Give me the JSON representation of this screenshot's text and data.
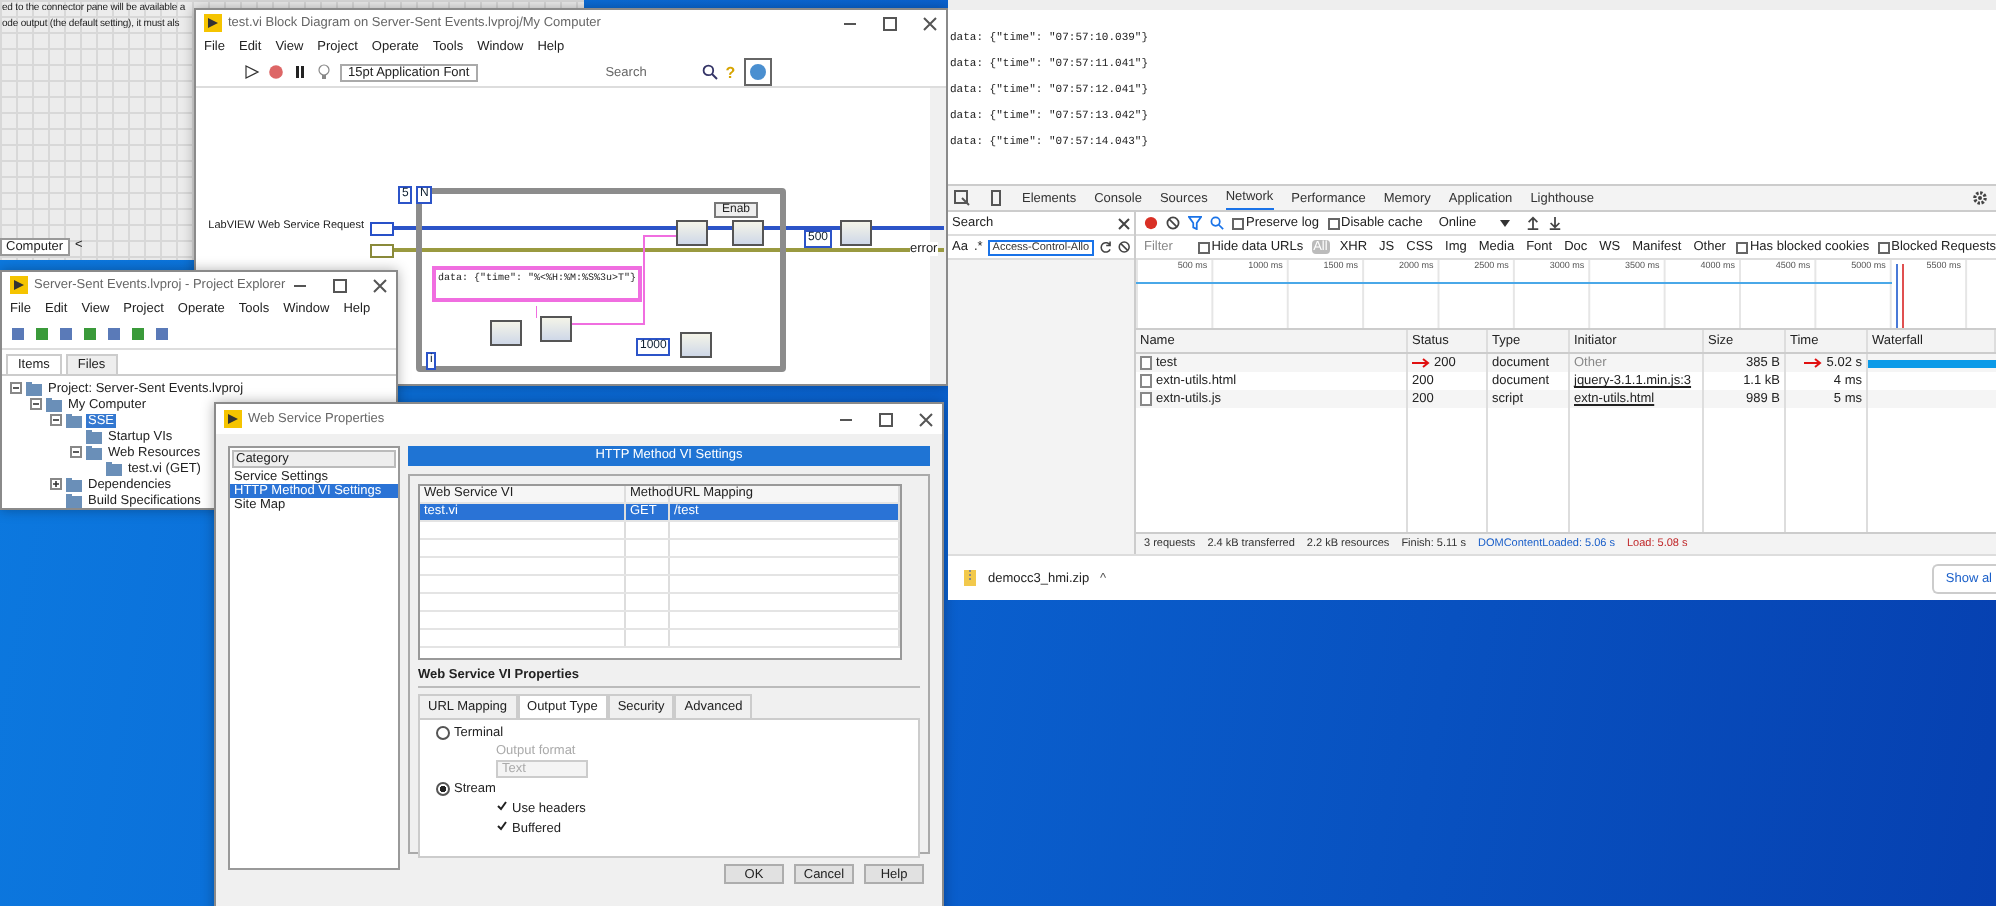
{
  "front_panel": {
    "lines": [
      "ed to the connector pane will be available a",
      "ode output (the default setting), it must als"
    ],
    "tab": "Computer",
    "scroll_arrow": "<"
  },
  "block_diagram": {
    "title": "test.vi Block Diagram on Server-Sent Events.lvproj/My Computer",
    "menu": [
      "File",
      "Edit",
      "View",
      "Project",
      "Operate",
      "Tools",
      "Window",
      "Help"
    ],
    "font_selector": "15pt Application Font",
    "search_placeholder": "Search",
    "help_glyph": "?",
    "loop_count": "5",
    "count_terminal": "N",
    "iteration_terminal": "i",
    "request_label": "LabVIEW Web Service Request",
    "format_string": "data: {\"time\": \"%<%H:%M:%S%3u>T\"}",
    "case_selector": "Enab",
    "delay_constant": "1000",
    "timeout_constant": "500",
    "error_label": "error"
  },
  "project_explorer": {
    "title": "Server-Sent Events.lvproj - Project Explorer",
    "menu": [
      "File",
      "Edit",
      "View",
      "Project",
      "Operate",
      "Tools",
      "Window",
      "Help"
    ],
    "tabs": [
      {
        "label": "Items",
        "selected": true
      },
      {
        "label": "Files",
        "selected": false
      }
    ],
    "tree": [
      {
        "label": "Project: Server-Sent Events.lvproj",
        "selected": false,
        "expanded": true,
        "children": [
          {
            "label": "My Computer",
            "selected": false,
            "expanded": true,
            "children": [
              {
                "label": "SSE",
                "selected": true,
                "expanded": true,
                "children": [
                  {
                    "label": "Startup VIs",
                    "selected": false
                  },
                  {
                    "label": "Web Resources",
                    "selected": false,
                    "expanded": true,
                    "children": [
                      {
                        "label": "test.vi (GET)",
                        "selected": false
                      }
                    ]
                  }
                ]
              },
              {
                "label": "Dependencies",
                "selected": false,
                "expanded": false
              },
              {
                "label": "Build Specifications",
                "selected": false
              }
            ]
          }
        ]
      }
    ]
  },
  "dialog": {
    "title": "Web Service Properties",
    "category_header": "Category",
    "categories": [
      {
        "label": "Service Settings",
        "selected": false
      },
      {
        "label": "HTTP Method VI Settings",
        "selected": true
      },
      {
        "label": "Site Map",
        "selected": false
      }
    ],
    "panel_header": "HTTP Method VI Settings",
    "table": {
      "columns": [
        "Web Service VI",
        "Method",
        "URL Mapping"
      ],
      "rows": [
        {
          "cells": [
            "test.vi",
            "GET",
            "/test"
          ],
          "selected": true
        }
      ]
    },
    "section": "Web Service VI Properties",
    "tabs": [
      {
        "label": "URL Mapping",
        "selected": false
      },
      {
        "label": "Output Type",
        "selected": true
      },
      {
        "label": "Security",
        "selected": false
      },
      {
        "label": "Advanced",
        "selected": false
      }
    ],
    "radios": [
      {
        "label": "Terminal",
        "selected": false
      },
      {
        "label": "Stream",
        "selected": true
      }
    ],
    "output_format": {
      "label": "Output format",
      "value": "Text",
      "disabled": true
    },
    "checkboxes": [
      {
        "label": "Use headers",
        "checked": true
      },
      {
        "label": "Buffered",
        "checked": true
      }
    ],
    "buttons": [
      "OK",
      "Cancel",
      "Help"
    ]
  },
  "browser": {
    "lines": [
      "data: {\"time\": \"07:57:10.039\"}",
      "data: {\"time\": \"07:57:11.041\"}",
      "data: {\"time\": \"07:57:12.041\"}",
      "data: {\"time\": \"07:57:13.042\"}",
      "data: {\"time\": \"07:57:14.043\"}"
    ],
    "devtools": {
      "tabs": [
        {
          "label": "Elements",
          "selected": false
        },
        {
          "label": "Console",
          "selected": false
        },
        {
          "label": "Sources",
          "selected": false
        },
        {
          "label": "Network",
          "selected": true
        },
        {
          "label": "Performance",
          "selected": false
        },
        {
          "label": "Memory",
          "selected": false
        },
        {
          "label": "Application",
          "selected": false
        },
        {
          "label": "Lighthouse",
          "selected": false
        }
      ],
      "search": {
        "title": "Search",
        "case_toggle": "Aa",
        "regex_toggle": ".*",
        "value": "Access-Control-Allo"
      },
      "options": [
        {
          "label": "Preserve log",
          "checked": false
        },
        {
          "label": "Disable cache",
          "checked": false
        }
      ],
      "throttling": "Online",
      "filter_placeholder": "Filter",
      "hide_data_urls": {
        "label": "Hide data URLs",
        "checked": false
      },
      "filter_types": [
        {
          "label": "All",
          "selected": true
        },
        {
          "label": "XHR",
          "selected": false
        },
        {
          "label": "JS",
          "selected": false
        },
        {
          "label": "CSS",
          "selected": false
        },
        {
          "label": "Img",
          "selected": false
        },
        {
          "label": "Media",
          "selected": false
        },
        {
          "label": "Font",
          "selected": false
        },
        {
          "label": "Doc",
          "selected": false
        },
        {
          "label": "WS",
          "selected": false
        },
        {
          "label": "Manifest",
          "selected": false
        },
        {
          "label": "Other",
          "selected": false
        }
      ],
      "blocked_filters": [
        {
          "label": "Has blocked cookies",
          "checked": false
        },
        {
          "label": "Blocked Requests",
          "checked": false
        }
      ],
      "timeline_ticks": [
        "500 ms",
        "1000 ms",
        "1500 ms",
        "2000 ms",
        "2500 ms",
        "3000 ms",
        "3500 ms",
        "4000 ms",
        "4500 ms",
        "5000 ms",
        "5500 ms"
      ],
      "columns": [
        "Name",
        "Status",
        "Type",
        "Initiator",
        "Size",
        "Time",
        "Waterfall"
      ],
      "rows": [
        {
          "name": "test",
          "status": "200",
          "type": "document",
          "initiator": "Other",
          "initiator_link": false,
          "size": "385 B",
          "time": "5.02 s",
          "flagged": true
        },
        {
          "name": "extn-utils.html",
          "status": "200",
          "type": "document",
          "initiator": "jquery-3.1.1.min.js:3",
          "initiator_link": true,
          "size": "1.1 kB",
          "time": "4 ms",
          "flagged": false
        },
        {
          "name": "extn-utils.js",
          "status": "200",
          "type": "script",
          "initiator": "extn-utils.html",
          "initiator_link": true,
          "size": "989 B",
          "time": "5 ms",
          "flagged": false
        }
      ],
      "summary": [
        {
          "text": "3 requests",
          "kind": "plain"
        },
        {
          "text": "2.4 kB transferred",
          "kind": "plain"
        },
        {
          "text": "2.2 kB resources",
          "kind": "plain"
        },
        {
          "text": "Finish: 5.11 s",
          "kind": "plain"
        },
        {
          "text": "DOMContentLoaded: 5.06 s",
          "kind": "dom"
        },
        {
          "text": "Load: 5.08 s",
          "kind": "load"
        }
      ]
    },
    "download": {
      "file": "democc3_hmi.zip",
      "caret": "^",
      "show_all": "Show al"
    }
  }
}
